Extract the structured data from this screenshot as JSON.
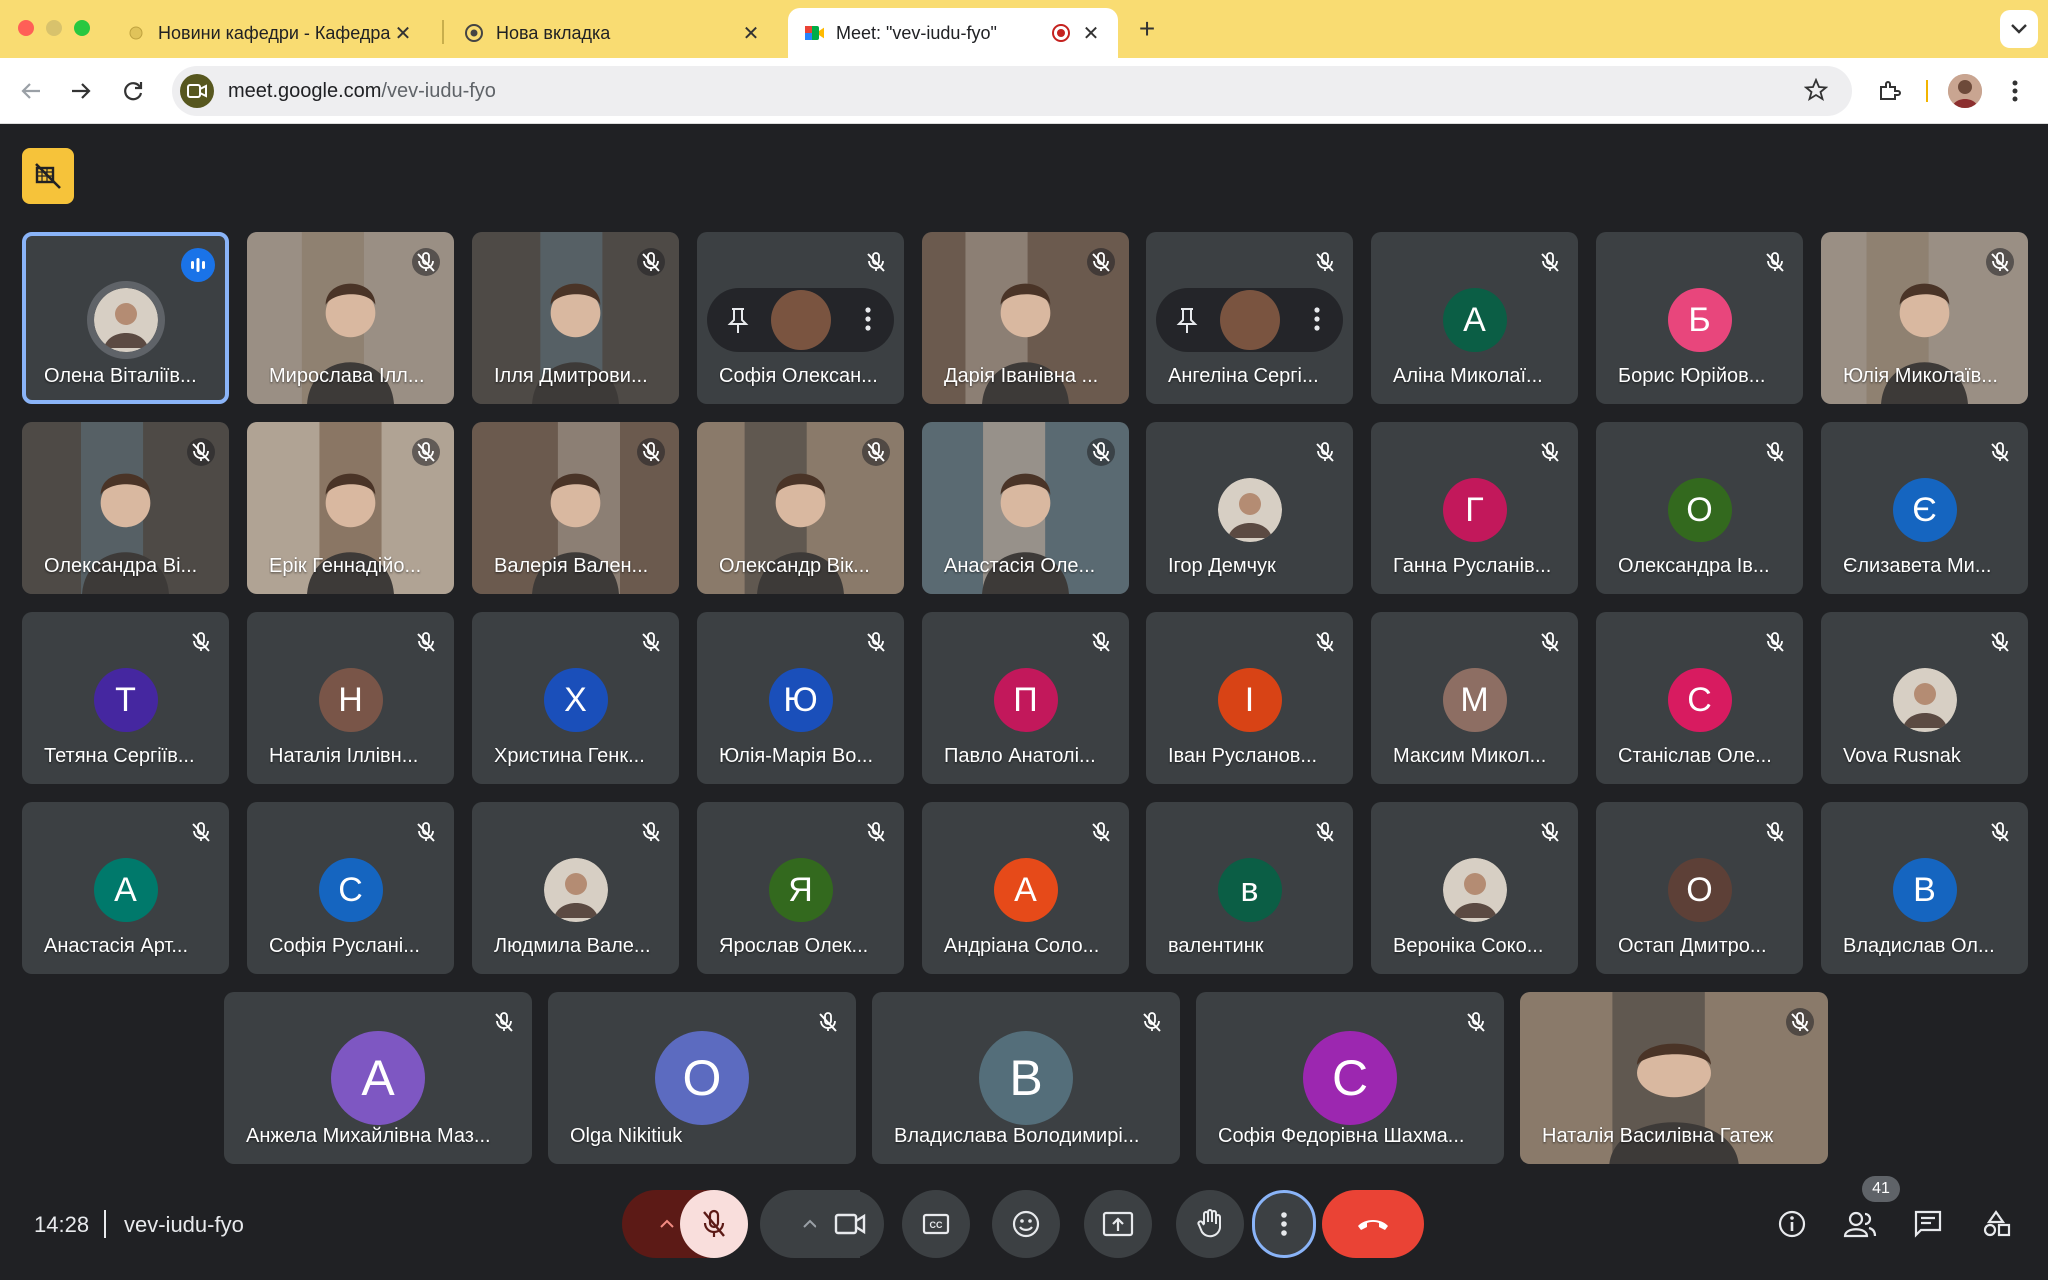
{
  "browser": {
    "tabs": [
      {
        "title": "Новини кафедри - Кафедра",
        "active": false
      },
      {
        "title": "Нова вкладка",
        "active": false
      },
      {
        "title": "Meet: \"vev-iudu-fyo\"",
        "active": true
      }
    ],
    "url_domain": "meet.google.com",
    "url_path": "/vev-iudu-fyo"
  },
  "meeting": {
    "time": "14:28",
    "code": "vev-iudu-fyo",
    "participant_count": "41"
  },
  "colors": {
    "accent_blue": "#8ab4f8",
    "hangup_red": "#ea4335",
    "tab_strip_yellow": "#f9dc72"
  },
  "participants": [
    {
      "name": "Олена Віталіїв...",
      "type": "photo",
      "speaking": true
    },
    {
      "name": "Мирослава Ілл...",
      "type": "video"
    },
    {
      "name": "Ілля Дмитрови...",
      "type": "video"
    },
    {
      "name": "Софія Олексан...",
      "type": "hover"
    },
    {
      "name": "Дарія Іванівна ...",
      "type": "video"
    },
    {
      "name": "Ангеліна Сергі...",
      "type": "hover"
    },
    {
      "name": "Аліна Миколаї...",
      "type": "letter",
      "letter": "А",
      "color": "#0b5e45"
    },
    {
      "name": "Борис Юрійов...",
      "type": "letter",
      "letter": "Б",
      "color": "#e8467c"
    },
    {
      "name": "Юлія Миколаїв...",
      "type": "video"
    },
    {
      "name": "Олександра Ві...",
      "type": "video"
    },
    {
      "name": "Ерік Геннадійо...",
      "type": "video"
    },
    {
      "name": "Валерія Вален...",
      "type": "video"
    },
    {
      "name": "Олександр Вік...",
      "type": "video"
    },
    {
      "name": "Анастасія Оле...",
      "type": "video"
    },
    {
      "name": "Ігор Демчук",
      "type": "photo"
    },
    {
      "name": "Ганна Русланів...",
      "type": "letter",
      "letter": "Г",
      "color": "#c2185b"
    },
    {
      "name": "Олександра Ів...",
      "type": "letter",
      "letter": "О",
      "color": "#33691e"
    },
    {
      "name": "Єлизавета Ми...",
      "type": "letter",
      "letter": "Є",
      "color": "#1565c0"
    },
    {
      "name": "Тетяна Сергіїв...",
      "type": "letter",
      "letter": "Т",
      "color": "#4527a0"
    },
    {
      "name": "Наталія Іллівн...",
      "type": "letter",
      "letter": "Н",
      "color": "#795548"
    },
    {
      "name": "Христина Генк...",
      "type": "letter",
      "letter": "Х",
      "color": "#1a4fba"
    },
    {
      "name": "Юлія-Марія Во...",
      "type": "letter",
      "letter": "Ю",
      "color": "#1a4fba"
    },
    {
      "name": "Павло Анатолі...",
      "type": "letter",
      "letter": "П",
      "color": "#c2185b"
    },
    {
      "name": "Іван Русланов...",
      "type": "letter",
      "letter": "І",
      "color": "#d84315"
    },
    {
      "name": "Максим Микол...",
      "type": "letter",
      "letter": "М",
      "color": "#8d6e63"
    },
    {
      "name": "Станіслав Оле...",
      "type": "letter",
      "letter": "С",
      "color": "#d81b60"
    },
    {
      "name": "Vova Rusnak",
      "type": "photo"
    },
    {
      "name": "Анастасія Арт...",
      "type": "letter",
      "letter": "А",
      "color": "#00796b"
    },
    {
      "name": "Софія Руслані...",
      "type": "letter",
      "letter": "С",
      "color": "#1565c0"
    },
    {
      "name": "Людмила Вале...",
      "type": "photo"
    },
    {
      "name": "Ярослав Олек...",
      "type": "letter",
      "letter": "Я",
      "color": "#33691e"
    },
    {
      "name": "Андріана Соло...",
      "type": "letter",
      "letter": "А",
      "color": "#e64a19"
    },
    {
      "name": "валентинк",
      "type": "letter",
      "letter": "в",
      "color": "#0b5e45"
    },
    {
      "name": "Вероніка Соко...",
      "type": "photo"
    },
    {
      "name": "Остап Дмитро...",
      "type": "letter",
      "letter": "О",
      "color": "#5d4037"
    },
    {
      "name": "Владислав Ол...",
      "type": "letter",
      "letter": "В",
      "color": "#1565c0"
    },
    {
      "name": "Анжела Михайлівна Маз...",
      "type": "letter",
      "letter": "А",
      "color": "#7e57c2"
    },
    {
      "name": "Olga Nikitiuk",
      "type": "letter",
      "letter": "O",
      "color": "#5c6bc0"
    },
    {
      "name": "Владислава Володимирі...",
      "type": "letter",
      "letter": "В",
      "color": "#546e7a"
    },
    {
      "name": "Софія Федорівна Шахма...",
      "type": "letter",
      "letter": "С",
      "color": "#9c27b0"
    },
    {
      "name": "Наталія Василівна Гатеж",
      "type": "video"
    }
  ]
}
